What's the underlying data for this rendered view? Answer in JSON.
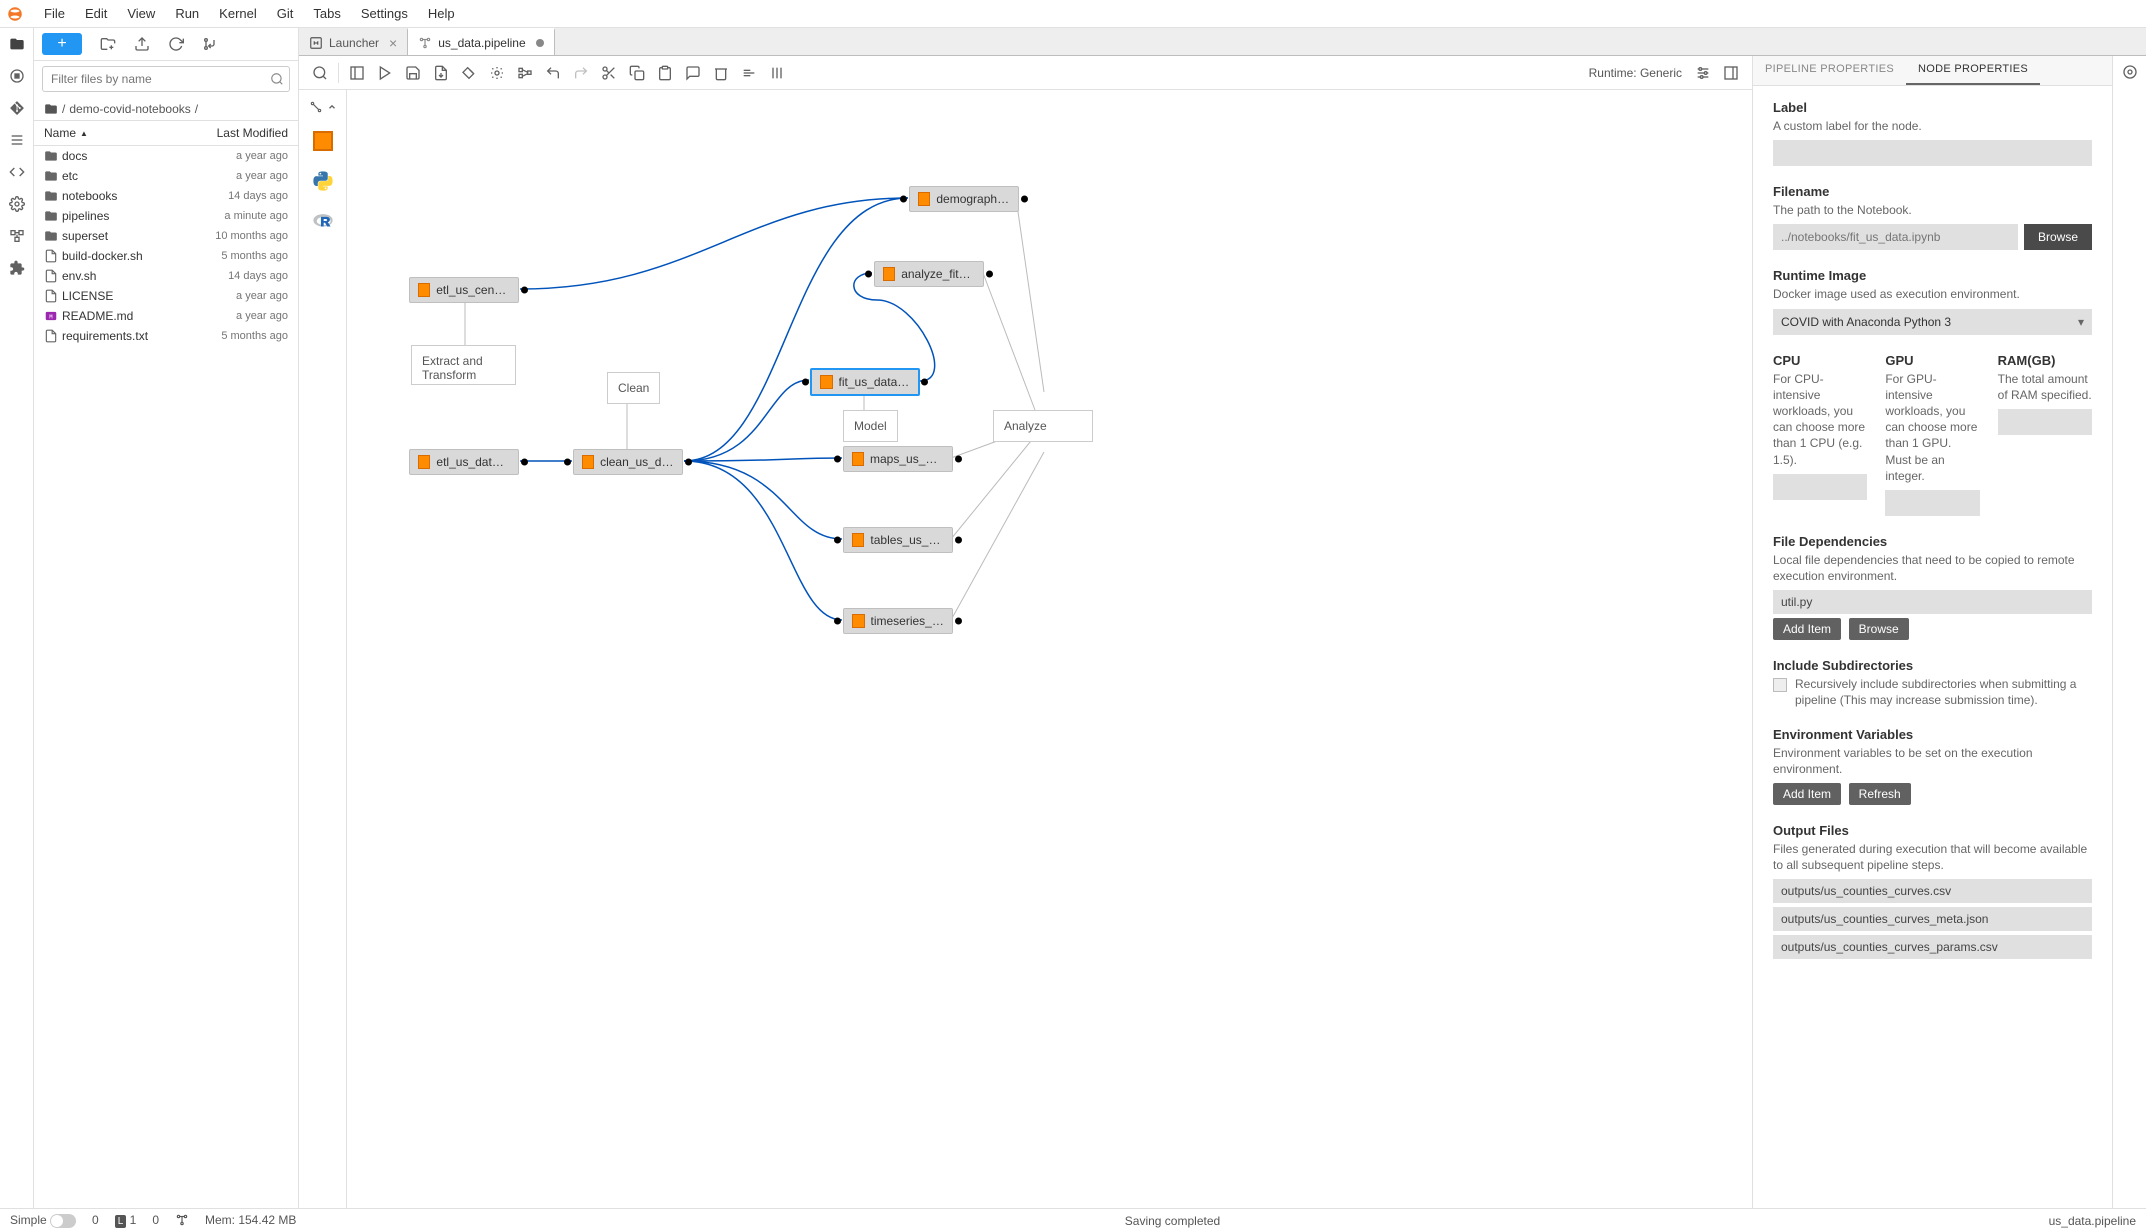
{
  "menu": [
    "File",
    "Edit",
    "View",
    "Run",
    "Kernel",
    "Git",
    "Tabs",
    "Settings",
    "Help"
  ],
  "filter_placeholder": "Filter files by name",
  "breadcrumb": {
    "sep": "/",
    "folder": "demo-covid-notebooks",
    "trail": "/"
  },
  "file_cols": {
    "name": "Name",
    "modified": "Last Modified"
  },
  "files": [
    {
      "icon": "folder",
      "name": "docs",
      "mod": "a year ago"
    },
    {
      "icon": "folder",
      "name": "etc",
      "mod": "a year ago"
    },
    {
      "icon": "folder",
      "name": "notebooks",
      "mod": "14 days ago"
    },
    {
      "icon": "folder",
      "name": "pipelines",
      "mod": "a minute ago"
    },
    {
      "icon": "folder",
      "name": "superset",
      "mod": "10 months ago"
    },
    {
      "icon": "file",
      "name": "build-docker.sh",
      "mod": "5 months ago"
    },
    {
      "icon": "file",
      "name": "env.sh",
      "mod": "14 days ago"
    },
    {
      "icon": "file",
      "name": "LICENSE",
      "mod": "a year ago"
    },
    {
      "icon": "md",
      "name": "README.md",
      "mod": "a year ago"
    },
    {
      "icon": "file",
      "name": "requirements.txt",
      "mod": "5 months ago"
    }
  ],
  "tabs": [
    {
      "icon": "launcher",
      "label": "Launcher",
      "closable": true,
      "active": false
    },
    {
      "icon": "pipeline",
      "label": "us_data.pipeline",
      "dirty": true,
      "active": true
    }
  ],
  "runtime_label": "Runtime: Generic",
  "nodes": {
    "etl_census": "etl_us_census...",
    "etl_data": "etl_us_data.ip...",
    "clean": "clean_us_data...",
    "demographics": "demographics...",
    "analyze_fit": "analyze_fit_us...",
    "fit": "fit_us_data.ip...",
    "maps": "maps_us_data...",
    "tables": "tables_us_dat...",
    "timeseries": "timeseries_us..."
  },
  "comments": {
    "extract": "Extract and Transform",
    "clean": "Clean",
    "model": "Model",
    "analyze": "Analyze"
  },
  "props_tabs": {
    "pipeline": "PIPELINE PROPERTIES",
    "node": "NODE PROPERTIES"
  },
  "props": {
    "label": {
      "title": "Label",
      "desc": "A custom label for the node."
    },
    "filename": {
      "title": "Filename",
      "desc": "The path to the Notebook.",
      "placeholder": "../notebooks/fit_us_data.ipynb",
      "browse": "Browse"
    },
    "runtime_image": {
      "title": "Runtime Image",
      "desc": "Docker image used as execution environment.",
      "value": "COVID with Anaconda Python 3"
    },
    "cpu": {
      "title": "CPU",
      "desc": "For CPU-intensive workloads, you can choose more than 1 CPU (e.g. 1.5)."
    },
    "gpu": {
      "title": "GPU",
      "desc": "For GPU-intensive workloads, you can choose more than 1 GPU. Must be an integer."
    },
    "ram": {
      "title": "RAM(GB)",
      "desc": "The total amount of RAM specified."
    },
    "file_deps": {
      "title": "File Dependencies",
      "desc": "Local file dependencies that need to be copied to remote execution environment.",
      "items": [
        "util.py"
      ],
      "add": "Add Item",
      "browse": "Browse"
    },
    "subdirs": {
      "title": "Include Subdirectories",
      "desc": "Recursively include subdirectories when submitting a pipeline (This may increase submission time)."
    },
    "env_vars": {
      "title": "Environment Variables",
      "desc": "Environment variables to be set on the execution environment.",
      "add": "Add Item",
      "refresh": "Refresh"
    },
    "outputs": {
      "title": "Output Files",
      "desc": "Files generated during execution that will become available to all subsequent pipeline steps.",
      "items": [
        "outputs/us_counties_curves.csv",
        "outputs/us_counties_curves_meta.json",
        "outputs/us_counties_curves_params.csv"
      ]
    }
  },
  "status": {
    "simple": "Simple",
    "zero1": "0",
    "ln": "1",
    "zero2": "0",
    "mem": "Mem: 154.42 MB",
    "saving": "Saving completed",
    "file": "us_data.pipeline"
  }
}
